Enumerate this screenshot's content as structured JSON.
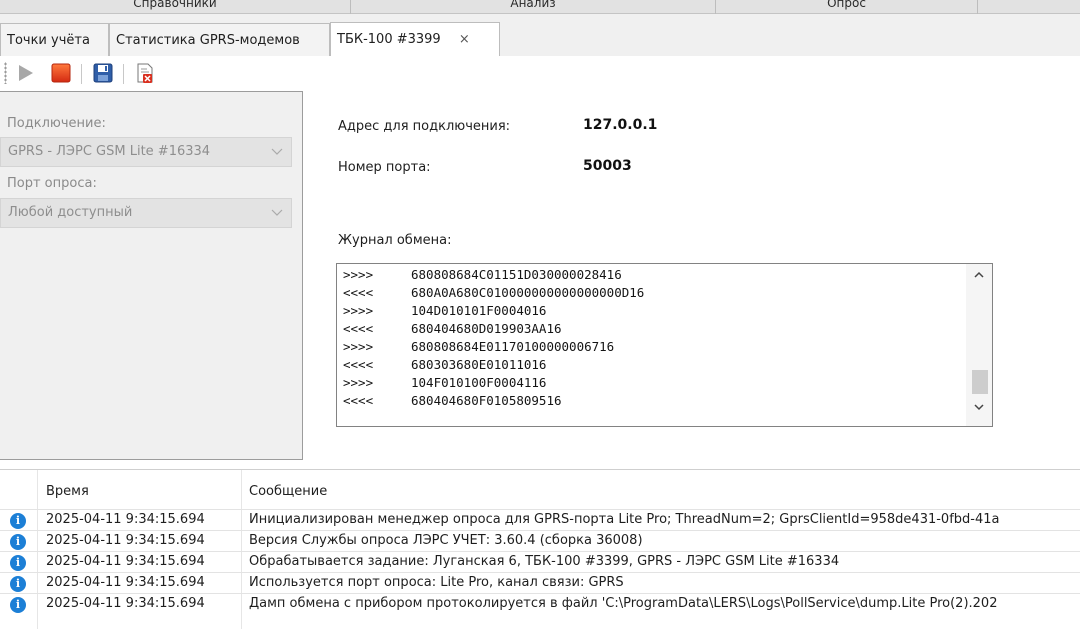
{
  "menu": {
    "items": [
      "Справочники",
      "Анализ",
      "Опрос"
    ]
  },
  "tabs": [
    {
      "label": "Точки учёта",
      "active": false
    },
    {
      "label": "Статистика GPRS-модемов",
      "active": false
    },
    {
      "label": "ТБК-100 #3399",
      "active": true,
      "closable": true
    }
  ],
  "tab_close_glyph": "×",
  "toolbar": {
    "icons": [
      "play-icon",
      "stop-icon",
      "save-icon",
      "delete-document-icon"
    ]
  },
  "connection": {
    "label": "Подключение:",
    "value": "GPRS - ЛЭРС GSM Lite #16334",
    "port_label": "Порт опроса:",
    "port_value": "Любой доступный"
  },
  "info": {
    "address_label": "Адрес для подключения:",
    "address_value": "127.0.0.1",
    "port_label": "Номер порта:",
    "port_value": "50003",
    "log_label": "Журнал обмена:"
  },
  "exchange_log": [
    {
      "dir": ">>>>",
      "data": "680808684C01151D030000028416"
    },
    {
      "dir": "<<<<",
      "data": "680A0A680C010000000000000000D16"
    },
    {
      "dir": ">>>>",
      "data": "104D010101F0004016"
    },
    {
      "dir": "<<<<",
      "data": "680404680D019903AA16"
    },
    {
      "dir": ">>>>",
      "data": "680808684E01170100000006716"
    },
    {
      "dir": "<<<<",
      "data": "680303680E01011016"
    },
    {
      "dir": ">>>>",
      "data": "104F010100F0004116"
    },
    {
      "dir": "<<<<",
      "data": "680404680F0105809516"
    }
  ],
  "messages": {
    "columns": {
      "time": "Время",
      "message": "Сообщение"
    },
    "rows": [
      {
        "time": "2025-04-11 9:34:15.694",
        "text": "Инициализирован менеджер опроса для GPRS-порта Lite Pro; ThreadNum=2; GprsClientId=958de431-0fbd-41a"
      },
      {
        "time": "2025-04-11 9:34:15.694",
        "text": "Версия Службы опроса ЛЭРС УЧЕТ: 3.60.4 (сборка 36008)"
      },
      {
        "time": "2025-04-11 9:34:15.694",
        "text": "Обрабатывается задание: Луганская 6, ТБК-100 #3399, GPRS - ЛЭРС GSM Lite #16334"
      },
      {
        "time": "2025-04-11 9:34:15.694",
        "text": "Используется порт опроса: Lite Pro, канал связи: GPRS"
      },
      {
        "time": "2025-04-11 9:34:15.694",
        "text": "Дамп обмена с прибором протоколируется в файл 'C:\\ProgramData\\LERS\\Logs\\PollService\\dump.Lite Pro(2).202"
      }
    ]
  },
  "colors": {
    "info_icon": "#1c7fd6",
    "stop": "#e53d1d",
    "play": "#a8a8a8"
  }
}
